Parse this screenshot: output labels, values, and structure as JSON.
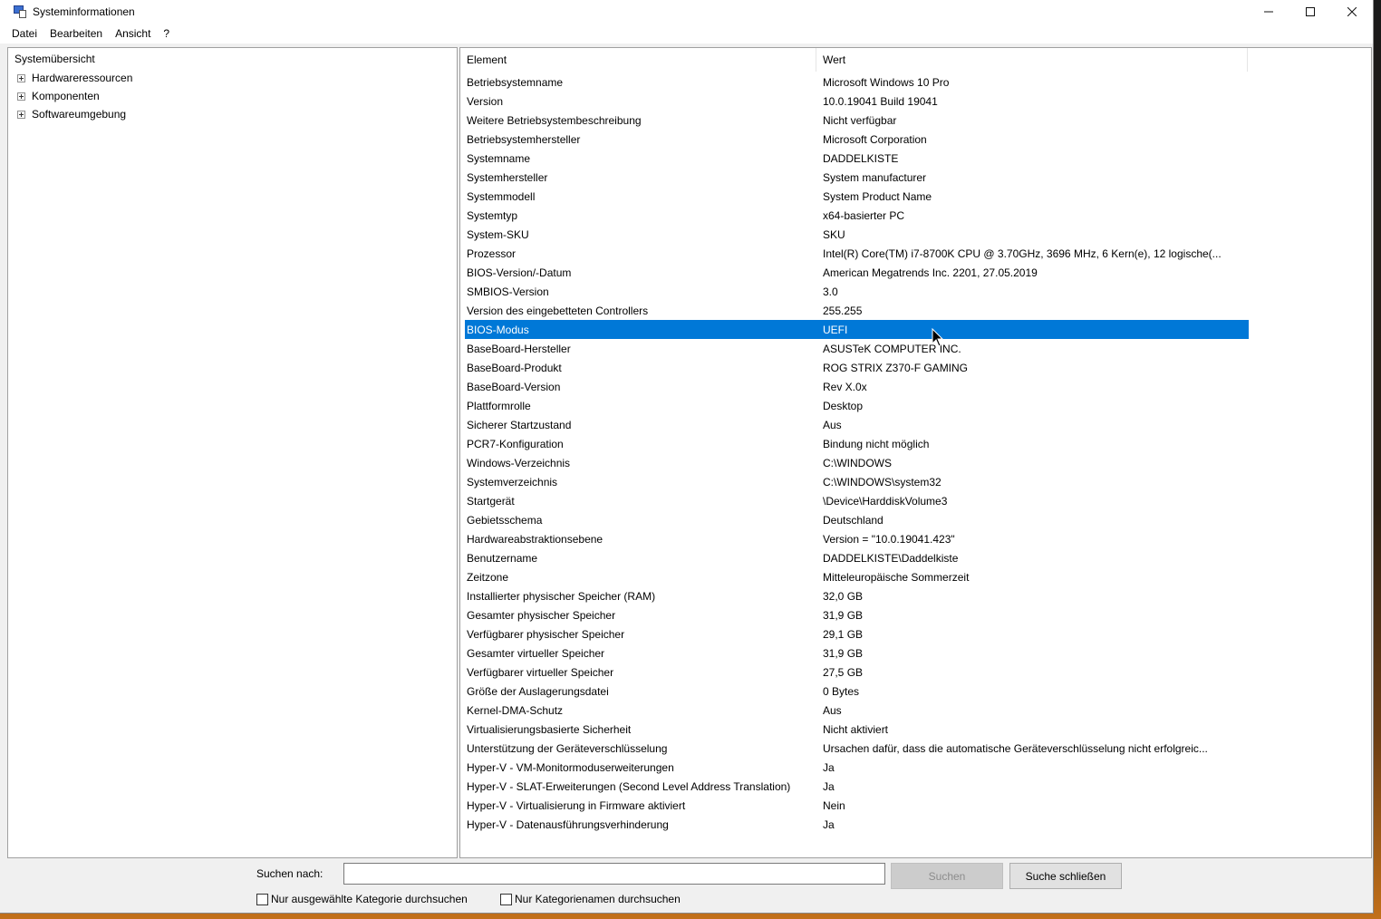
{
  "window": {
    "title": "Systeminformationen",
    "controls": {
      "minimize": "—",
      "maximize": "☐",
      "close": "✕"
    }
  },
  "menu": [
    "Datei",
    "Bearbeiten",
    "Ansicht",
    "?"
  ],
  "tree": {
    "root": "Systemübersicht",
    "nodes": [
      "Hardwareressourcen",
      "Komponenten",
      "Softwareumgebung"
    ]
  },
  "list": {
    "headers": {
      "element": "Element",
      "value": "Wert"
    },
    "selected_index": 13,
    "rows": [
      {
        "element": "Betriebsystemname",
        "value": "Microsoft Windows 10 Pro"
      },
      {
        "element": "Version",
        "value": "10.0.19041 Build 19041"
      },
      {
        "element": "Weitere Betriebsystembeschreibung",
        "value": "Nicht verfügbar"
      },
      {
        "element": "Betriebsystemhersteller",
        "value": "Microsoft Corporation"
      },
      {
        "element": "Systemname",
        "value": "DADDELKISTE"
      },
      {
        "element": "Systemhersteller",
        "value": "System manufacturer"
      },
      {
        "element": "Systemmodell",
        "value": "System Product Name"
      },
      {
        "element": "Systemtyp",
        "value": "x64-basierter PC"
      },
      {
        "element": "System-SKU",
        "value": "SKU"
      },
      {
        "element": "Prozessor",
        "value": "Intel(R) Core(TM) i7-8700K CPU @ 3.70GHz, 3696 MHz, 6 Kern(e), 12 logische(..."
      },
      {
        "element": "BIOS-Version/-Datum",
        "value": "American Megatrends Inc. 2201, 27.05.2019"
      },
      {
        "element": "SMBIOS-Version",
        "value": "3.0"
      },
      {
        "element": "Version des eingebetteten Controllers",
        "value": "255.255"
      },
      {
        "element": "BIOS-Modus",
        "value": "UEFI"
      },
      {
        "element": "BaseBoard-Hersteller",
        "value": "ASUSTeK COMPUTER INC."
      },
      {
        "element": "BaseBoard-Produkt",
        "value": "ROG STRIX Z370-F GAMING"
      },
      {
        "element": "BaseBoard-Version",
        "value": "Rev X.0x"
      },
      {
        "element": "Plattformrolle",
        "value": "Desktop"
      },
      {
        "element": "Sicherer Startzustand",
        "value": "Aus"
      },
      {
        "element": "PCR7-Konfiguration",
        "value": "Bindung nicht möglich"
      },
      {
        "element": "Windows-Verzeichnis",
        "value": "C:\\WINDOWS"
      },
      {
        "element": "Systemverzeichnis",
        "value": "C:\\WINDOWS\\system32"
      },
      {
        "element": "Startgerät",
        "value": "\\Device\\HarddiskVolume3"
      },
      {
        "element": "Gebietsschema",
        "value": "Deutschland"
      },
      {
        "element": "Hardwareabstraktionsebene",
        "value": "Version = \"10.0.19041.423\""
      },
      {
        "element": "Benutzername",
        "value": "DADDELKISTE\\Daddelkiste"
      },
      {
        "element": "Zeitzone",
        "value": "Mitteleuropäische Sommerzeit"
      },
      {
        "element": "Installierter physischer Speicher (RAM)",
        "value": "32,0 GB"
      },
      {
        "element": "Gesamter physischer Speicher",
        "value": "31,9 GB"
      },
      {
        "element": "Verfügbarer physischer Speicher",
        "value": "29,1 GB"
      },
      {
        "element": "Gesamter virtueller Speicher",
        "value": "31,9 GB"
      },
      {
        "element": "Verfügbarer virtueller Speicher",
        "value": "27,5 GB"
      },
      {
        "element": "Größe der Auslagerungsdatei",
        "value": "0 Bytes"
      },
      {
        "element": "Kernel-DMA-Schutz",
        "value": "Aus"
      },
      {
        "element": "Virtualisierungsbasierte Sicherheit",
        "value": "Nicht aktiviert"
      },
      {
        "element": "Unterstützung der Geräteverschlüsselung",
        "value": "Ursachen dafür, dass die automatische Geräteverschlüsselung nicht erfolgreic..."
      },
      {
        "element": "Hyper-V - VM-Monitormoduserweiterungen",
        "value": "Ja"
      },
      {
        "element": "Hyper-V - SLAT-Erweiterungen (Second Level Address Translation)",
        "value": "Ja"
      },
      {
        "element": "Hyper-V - Virtualisierung in Firmware aktiviert",
        "value": "Nein"
      },
      {
        "element": "Hyper-V - Datenausführungsverhinderung",
        "value": "Ja"
      }
    ]
  },
  "search": {
    "label": "Suchen nach:",
    "value": "",
    "search_button": "Suchen",
    "close_button": "Suche schließen",
    "check_selected_category": "Nur ausgewählte Kategorie durchsuchen",
    "check_category_names": "Nur Kategorienamen durchsuchen"
  },
  "colors": {
    "selection": "#0078d7"
  }
}
